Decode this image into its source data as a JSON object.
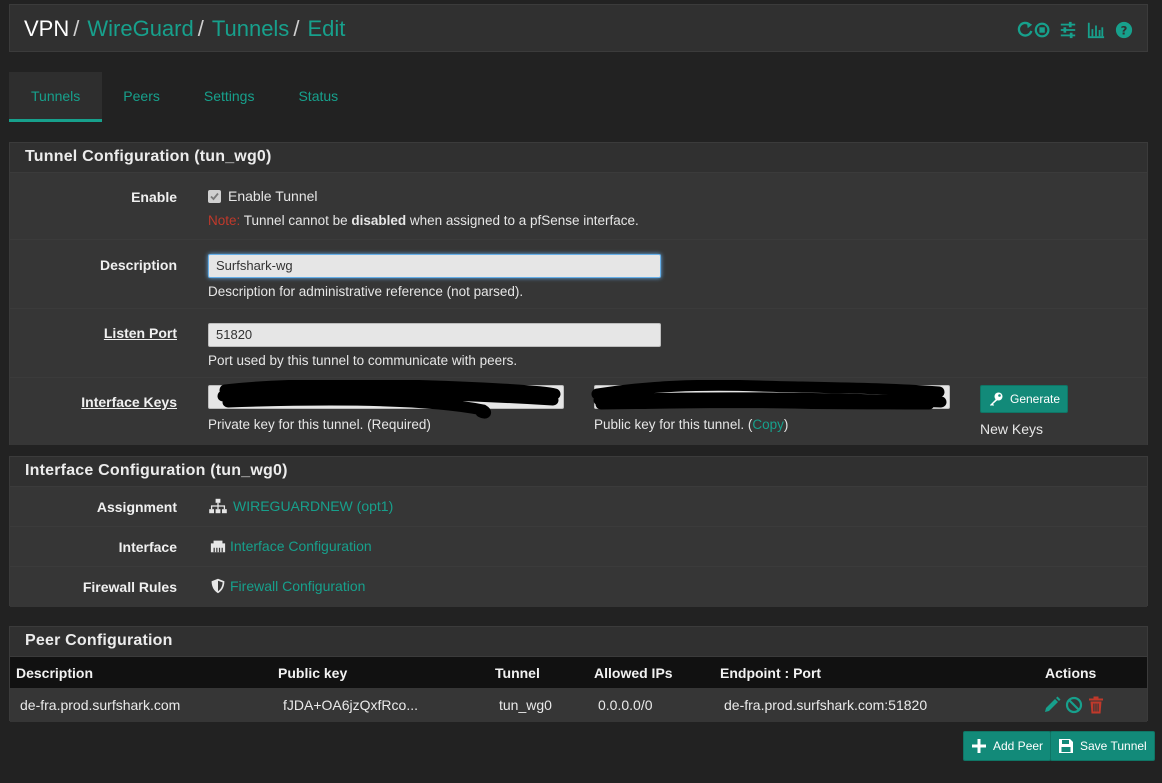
{
  "header": {
    "breadcrumb": {
      "root": "VPN",
      "sep": "/",
      "crumb2": "WireGuard",
      "crumb3": "Tunnels",
      "crumb4": "Edit"
    },
    "icons": [
      "reload-icon",
      "stop-icon",
      "sliders-icon",
      "chart-icon",
      "help-icon"
    ],
    "accent": "#17a08c"
  },
  "tabs": [
    "Tunnels",
    "Peers",
    "Settings",
    "Status"
  ],
  "tunnel": {
    "title": "Tunnel Configuration (tun_wg0)",
    "enable": {
      "label": "Enable",
      "checkbox_label": "Enable Tunnel",
      "note_prefix": "Note:",
      "note_a": " Tunnel cannot be ",
      "note_bold": "disabled",
      "note_b": " when assigned to a pfSense interface."
    },
    "description": {
      "label": "Description",
      "value": "Surfshark-wg",
      "help": "Description for administrative reference (not parsed)."
    },
    "listen_port": {
      "label": "Listen Port",
      "value": "51820",
      "help": "Port used by this tunnel to communicate with peers."
    },
    "keys": {
      "label": "Interface Keys",
      "private_help": "Private key for this tunnel. (Required)",
      "public_help_a": "Public key for this tunnel. (",
      "public_copy": "Copy",
      "public_help_b": ")",
      "generate_label": "Generate",
      "new_keys": "New Keys"
    }
  },
  "interface": {
    "title": "Interface Configuration (tun_wg0)",
    "assignment": {
      "label": "Assignment",
      "value": "WIREGUARDNEW (opt1)"
    },
    "interface": {
      "label": "Interface",
      "value": "Interface Configuration"
    },
    "firewall": {
      "label": "Firewall Rules",
      "value": "Firewall Configuration"
    }
  },
  "peers": {
    "title": "Peer Configuration",
    "columns": {
      "description": "Description",
      "public_key": "Public key",
      "tunnel": "Tunnel",
      "allowed_ips": "Allowed IPs",
      "endpoint": "Endpoint : Port",
      "actions": "Actions"
    },
    "rows": [
      {
        "description": "de-fra.prod.surfshark.com",
        "public_key": "fJDA+OA6jzQxfRco...",
        "tunnel": "tun_wg0",
        "allowed_ips": "0.0.0.0/0",
        "endpoint": "de-fra.prod.surfshark.com:51820"
      }
    ]
  },
  "buttons": {
    "add_peer": "Add Peer",
    "save_tunnel": "Save Tunnel"
  },
  "colors": {
    "danger": "#c0392b",
    "button": "#128a79"
  }
}
